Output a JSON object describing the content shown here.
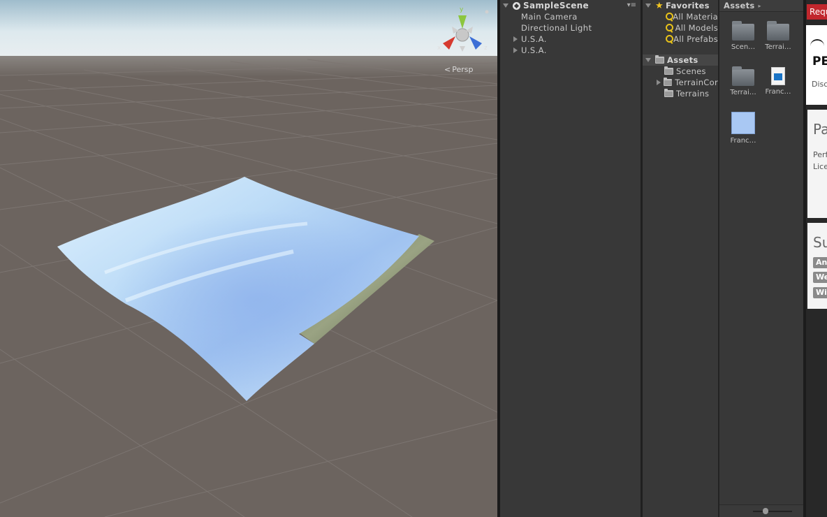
{
  "scene_view": {
    "projection_label": "Persp",
    "gizmo": {
      "y_label": "y",
      "x_label": "x",
      "z_label": "z"
    }
  },
  "hierarchy": {
    "title": "SampleScene",
    "items": [
      {
        "label": "Main Camera",
        "expandable": false
      },
      {
        "label": "Directional Light",
        "expandable": false
      },
      {
        "label": "U.S.A.",
        "expandable": true
      },
      {
        "label": "U.S.A.",
        "expandable": true
      }
    ]
  },
  "project_tree": {
    "favorites_label": "Favorites",
    "favorites": [
      "All Materia",
      "All Models",
      "All Prefabs"
    ],
    "assets_label": "Assets",
    "folders": [
      {
        "label": "Scenes",
        "expandable": false
      },
      {
        "label": "TerrainCor",
        "expandable": true
      },
      {
        "label": "Terrains",
        "expandable": false
      }
    ]
  },
  "assets_panel": {
    "breadcrumb": "Assets",
    "items": [
      {
        "label": "Scen…",
        "kind": "folder"
      },
      {
        "label": "Terrai…",
        "kind": "folder"
      },
      {
        "label": "Terrai…",
        "kind": "folder"
      },
      {
        "label": "Franc…",
        "kind": "image"
      },
      {
        "label": "Franc…",
        "kind": "texture"
      }
    ]
  },
  "inspector": {
    "request_button": "Requ",
    "title_text": "PE",
    "disc_text": "Disc",
    "section1_heading": "Pa",
    "perf_text": "Perf",
    "lice_text": "Lice",
    "section2_heading": "Su",
    "tags": [
      "An",
      "We",
      "Wi"
    ]
  },
  "colors": {
    "sky_top": "#c7dde9",
    "ground": "#6c645f",
    "panel_bg": "#383838",
    "gizmo_x": "#d63a2f",
    "gizmo_y": "#8cc63f",
    "gizmo_z": "#3d6fd6",
    "request_red": "#c1272d"
  }
}
